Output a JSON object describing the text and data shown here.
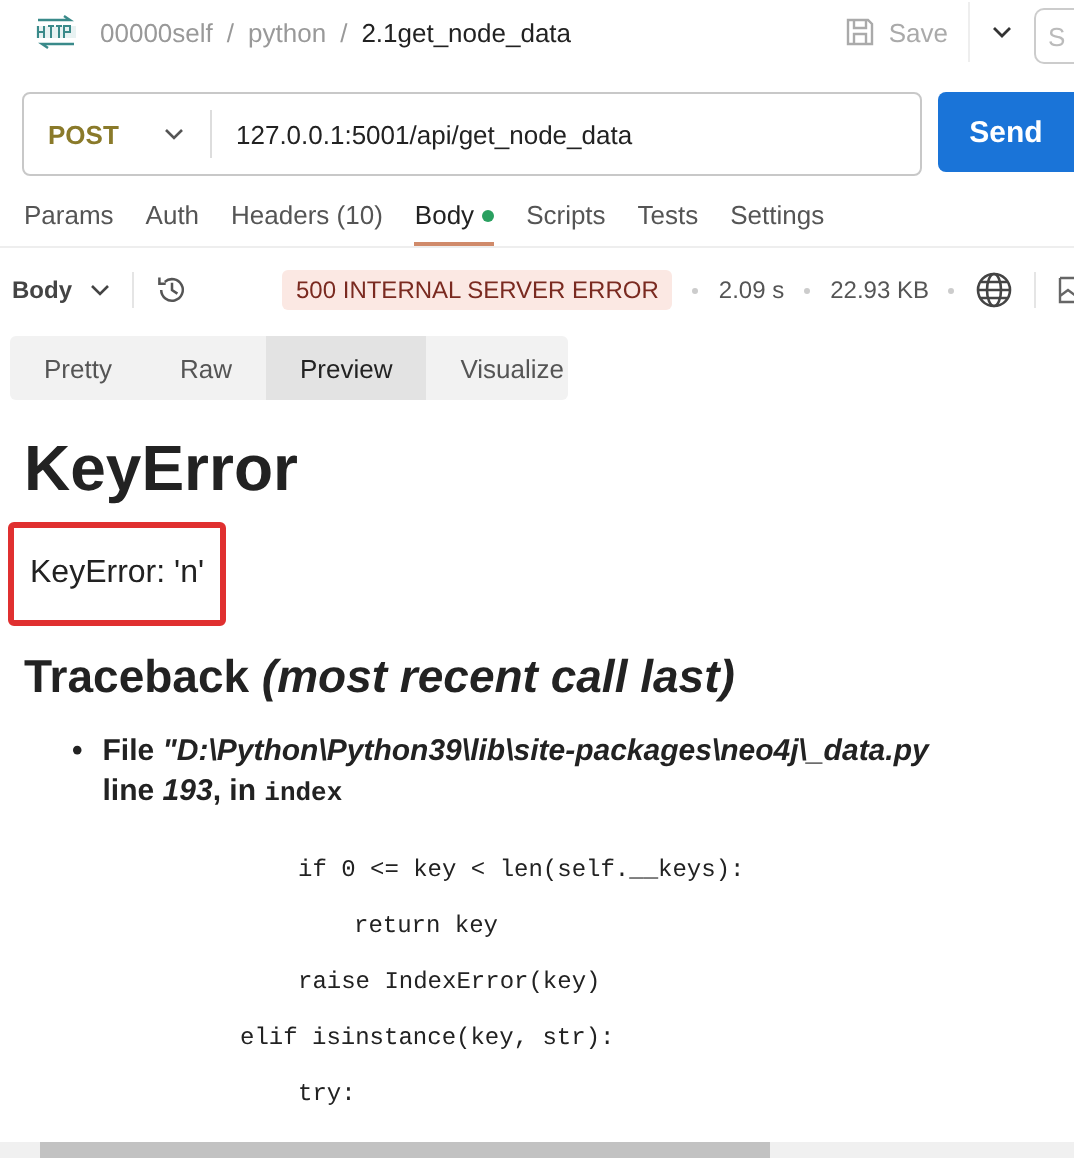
{
  "breadcrumb": {
    "items": [
      "00000self",
      "python"
    ],
    "separator": "/",
    "current": "2.1get_node_data"
  },
  "save": {
    "label": "Save",
    "disabled": true
  },
  "share_partial": "S",
  "request": {
    "method": "POST",
    "url": "127.0.0.1:5001/api/get_node_data",
    "send": "Send"
  },
  "tabs": [
    {
      "label": "Params",
      "selected": false,
      "indicator": false
    },
    {
      "label": "Auth",
      "selected": false,
      "indicator": false
    },
    {
      "label": "Headers (10)",
      "selected": false,
      "indicator": false
    },
    {
      "label": "Body",
      "selected": true,
      "indicator": true
    },
    {
      "label": "Scripts",
      "selected": false,
      "indicator": false
    },
    {
      "label": "Tests",
      "selected": false,
      "indicator": false
    },
    {
      "label": "Settings",
      "selected": false,
      "indicator": false
    }
  ],
  "response": {
    "body_label": "Body",
    "status": "500 INTERNAL SERVER ERROR",
    "time": "2.09 s",
    "size": "22.93 KB"
  },
  "view_tabs": [
    {
      "label": "Pretty",
      "selected": false
    },
    {
      "label": "Raw",
      "selected": false
    },
    {
      "label": "Preview",
      "selected": true
    },
    {
      "label": "Visualize",
      "selected": false
    }
  ],
  "preview": {
    "title": "KeyError",
    "message": "KeyError: 'n'",
    "message_highlighted": true,
    "traceback_heading": "Traceback *(most recent call last)*",
    "frames": [
      {
        "bullet": "•",
        "file": "File *\"D:\\Python\\Python39\\lib\\site-packages\\neo4j\\_data.py*",
        "line": "line *193*, in",
        "function": "index"
      }
    ],
    "code": [
      {
        "kind": "block",
        "text": "if 0 <= key < len(self.__keys):"
      },
      {
        "kind": "nested",
        "text": "return key"
      },
      {
        "kind": "block",
        "text": "raise IndexError(key)"
      },
      {
        "kind": "outer",
        "text": "elif isinstance(key, str):"
      },
      {
        "kind": "block",
        "text": "try:"
      }
    ]
  }
}
